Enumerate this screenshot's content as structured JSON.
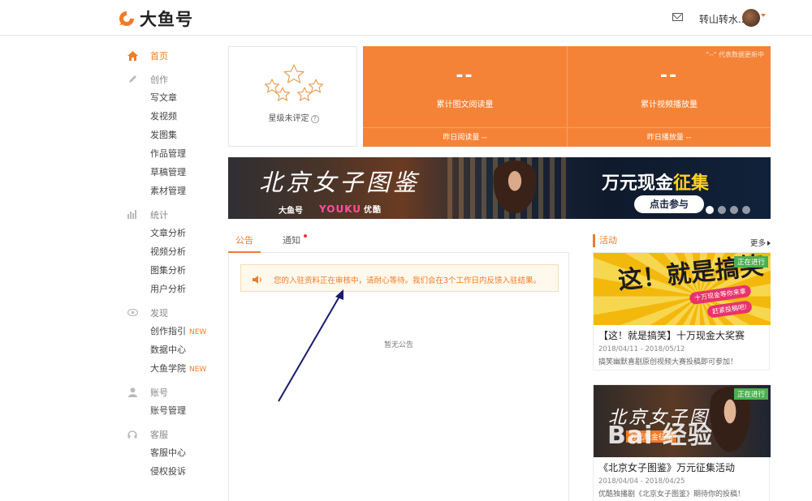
{
  "header": {
    "brand": "大鱼号",
    "username": "转山转水..."
  },
  "sidebar": {
    "home": "首页",
    "groups": [
      {
        "title": "创作",
        "items": [
          "写文章",
          "发视频",
          "发图集",
          "作品管理",
          "草稿管理",
          "素材管理"
        ]
      },
      {
        "title": "统计",
        "items": [
          "文章分析",
          "视频分析",
          "图集分析",
          "用户分析"
        ]
      },
      {
        "title": "发现",
        "items": [
          "创作指引",
          "数据中心",
          "大鱼学院"
        ]
      },
      {
        "title": "账号",
        "items": [
          "账号管理"
        ]
      },
      {
        "title": "客服",
        "items": [
          "客服中心",
          "侵权投诉"
        ]
      }
    ],
    "new_tag": "NEW"
  },
  "rating": {
    "label": "星级未评定",
    "help": "?"
  },
  "stats": {
    "note": "\"--\" 代表数据更新中",
    "columns": [
      {
        "value": "--",
        "name": "累计图文阅读量",
        "sub": "昨日阅读量 --"
      },
      {
        "value": "--",
        "name": "累计视频播放量",
        "sub": "昨日播放量 --"
      }
    ]
  },
  "banner": {
    "title": "北京女子图鉴",
    "brand_a": "大鱼号",
    "brand_b": "YOUKU",
    "brand_b_cn": "优酷",
    "headline_a": "万元现金",
    "headline_b": "征集",
    "cta": "点击参与",
    "slides": 4,
    "active_slide": 1
  },
  "tabs": {
    "announcement": "公告",
    "notice": "通知"
  },
  "notice": {
    "text": "您的入驻资料正在审核中，请耐心等待。我们会在3个工作日内反馈入驻结果。",
    "empty": "暂无公告"
  },
  "activities": {
    "title": "活动",
    "more": "更多",
    "items": [
      {
        "badge": "正在进行",
        "image_text": "这！就是搞笑",
        "image_tag1": "十万现金等你来拿",
        "image_tag2": "赶紧投稿吧!",
        "title": "【这！就是搞笑】十万现金大奖赛",
        "date": "2018/04/11 - 2018/05/12",
        "desc": "搞笑幽默喜剧原创视频大赛投稿即可参加！"
      },
      {
        "badge": "正在进行",
        "image_text": "北京女子图鉴",
        "image_tag1": "万元现金征集",
        "title": "《北京女子图鉴》万元征集活动",
        "date": "2018/04/04 - 2018/04/25",
        "desc": "优酷独播剧《北京女子图鉴》期待你的投稿！"
      }
    ]
  },
  "watermark": "Bai 经验"
}
